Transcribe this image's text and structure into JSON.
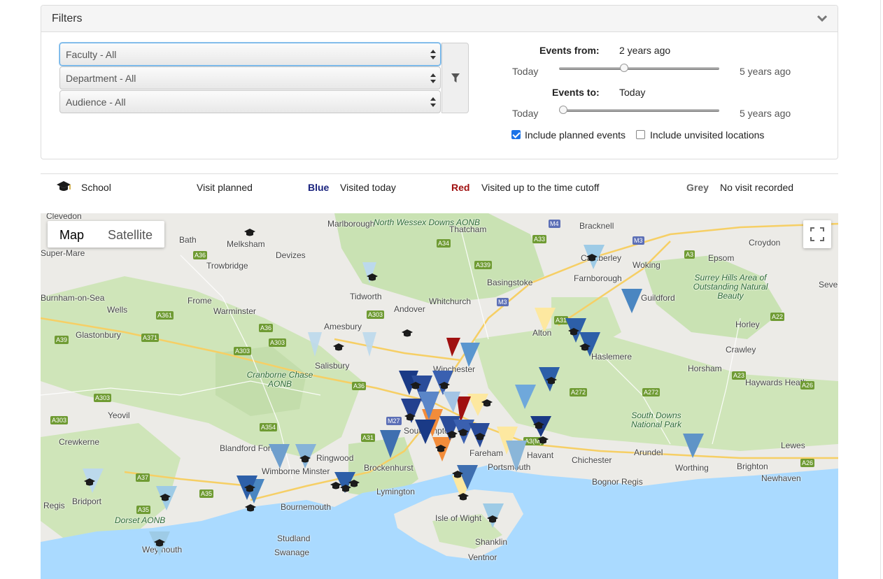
{
  "filters": {
    "title": "Filters",
    "faculty_select": "Faculty - All",
    "department_select": "Department - All",
    "audience_select": "Audience - All",
    "events_from_label": "Events from:",
    "events_from_value": "2 years ago",
    "events_to_label": "Events to:",
    "events_to_value": "Today",
    "range_min": "Today",
    "range_max": "5 years ago",
    "events_from_level": 0.4,
    "events_to_level": 0.0,
    "include_planned_label": "Include planned events",
    "include_planned_checked": true,
    "include_unvisited_label": "Include unvisited locations",
    "include_unvisited_checked": false
  },
  "legend": {
    "school_label": "School",
    "planned_label": "Visit planned",
    "blue_key": "Blue",
    "blue_label": "Visited today",
    "red_key": "Red",
    "red_label": "Visited up to the time cutoff",
    "grey_key": "Grey",
    "grey_label": "No visit recorded",
    "colors": {
      "blue": "#1a237e",
      "red": "#a01010",
      "grey": "#666666"
    }
  },
  "map": {
    "map_button": "Map",
    "satellite_button": "Satellite",
    "places": [
      "Clevedon",
      "Marlborough",
      "Bracknell",
      "Bath",
      "Melksham",
      "Devizes",
      "Thatcham",
      "Croydon",
      "Trowbridge",
      "Camberley",
      "Woking",
      "Epsom",
      "Farnborough",
      "Tidworth",
      "Basingstoke",
      "Wells",
      "Frome",
      "Warminster",
      "Andover",
      "Whitchurch",
      "Guildford",
      "Amesbury",
      "Alton",
      "Horley",
      "Glastonbury",
      "Crawley",
      "Salisbury",
      "Winchester",
      "Haslemere",
      "Horsham",
      "Haywards Heath",
      "Yeovil",
      "Southampton",
      "Crewkerne",
      "Blandford Forum",
      "Ringwood",
      "Brockenhurst",
      "Fareham",
      "Havant",
      "Chichester",
      "Arundel",
      "Lewes",
      "Wimborne Minster",
      "Portsmouth",
      "Worthing",
      "Brighton",
      "Bridport",
      "Bournemouth",
      "Lymington",
      "Bognor Regis",
      "Newhaven",
      "Isle of Wight",
      "Studland",
      "Swanage",
      "Shanklin",
      "Weymouth",
      "Ventnor",
      "Regis",
      "Sevenoaks",
      "Super-Mare",
      "Burnham-on-Sea"
    ],
    "areas": [
      "North Wessex Downs AONB",
      "Surrey Hills Area of Outstanding Natural Beauty",
      "Cranborne Chase AONB",
      "South Downs National Park",
      "Dorset AONB"
    ]
  }
}
